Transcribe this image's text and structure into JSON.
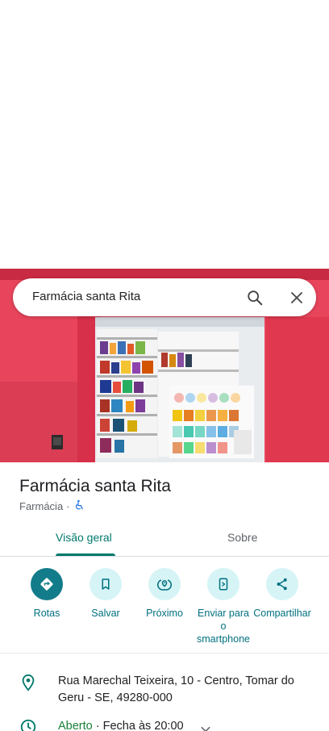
{
  "search": {
    "query": "Farmácia santa Rita"
  },
  "place": {
    "name": "Farmácia santa Rita",
    "category": "Farmácia",
    "separator": "·"
  },
  "tabs": [
    {
      "label": "Visão geral",
      "active": true
    },
    {
      "label": "Sobre",
      "active": false
    }
  ],
  "actions": [
    {
      "label": "Rotas",
      "icon": "directions-icon"
    },
    {
      "label": "Salvar",
      "icon": "bookmark-icon"
    },
    {
      "label": "Próximo",
      "icon": "nearby-icon"
    },
    {
      "label": "Enviar para o smartphone",
      "icon": "send-to-phone-icon"
    },
    {
      "label": "Compartilhar",
      "icon": "share-icon"
    }
  ],
  "info": {
    "address": "Rua Marechal Teixeira, 10 - Centro, Tomar do Geru - SE, 49280-000",
    "hours_status": "Aberto",
    "hours_detail": "· Fecha às 20:00"
  },
  "colors": {
    "accent": "#00796b",
    "action_bg": "#d6f4f6",
    "primary_action": "#137c8a",
    "open_green": "#188038",
    "storefront_red": "#e0394f"
  }
}
